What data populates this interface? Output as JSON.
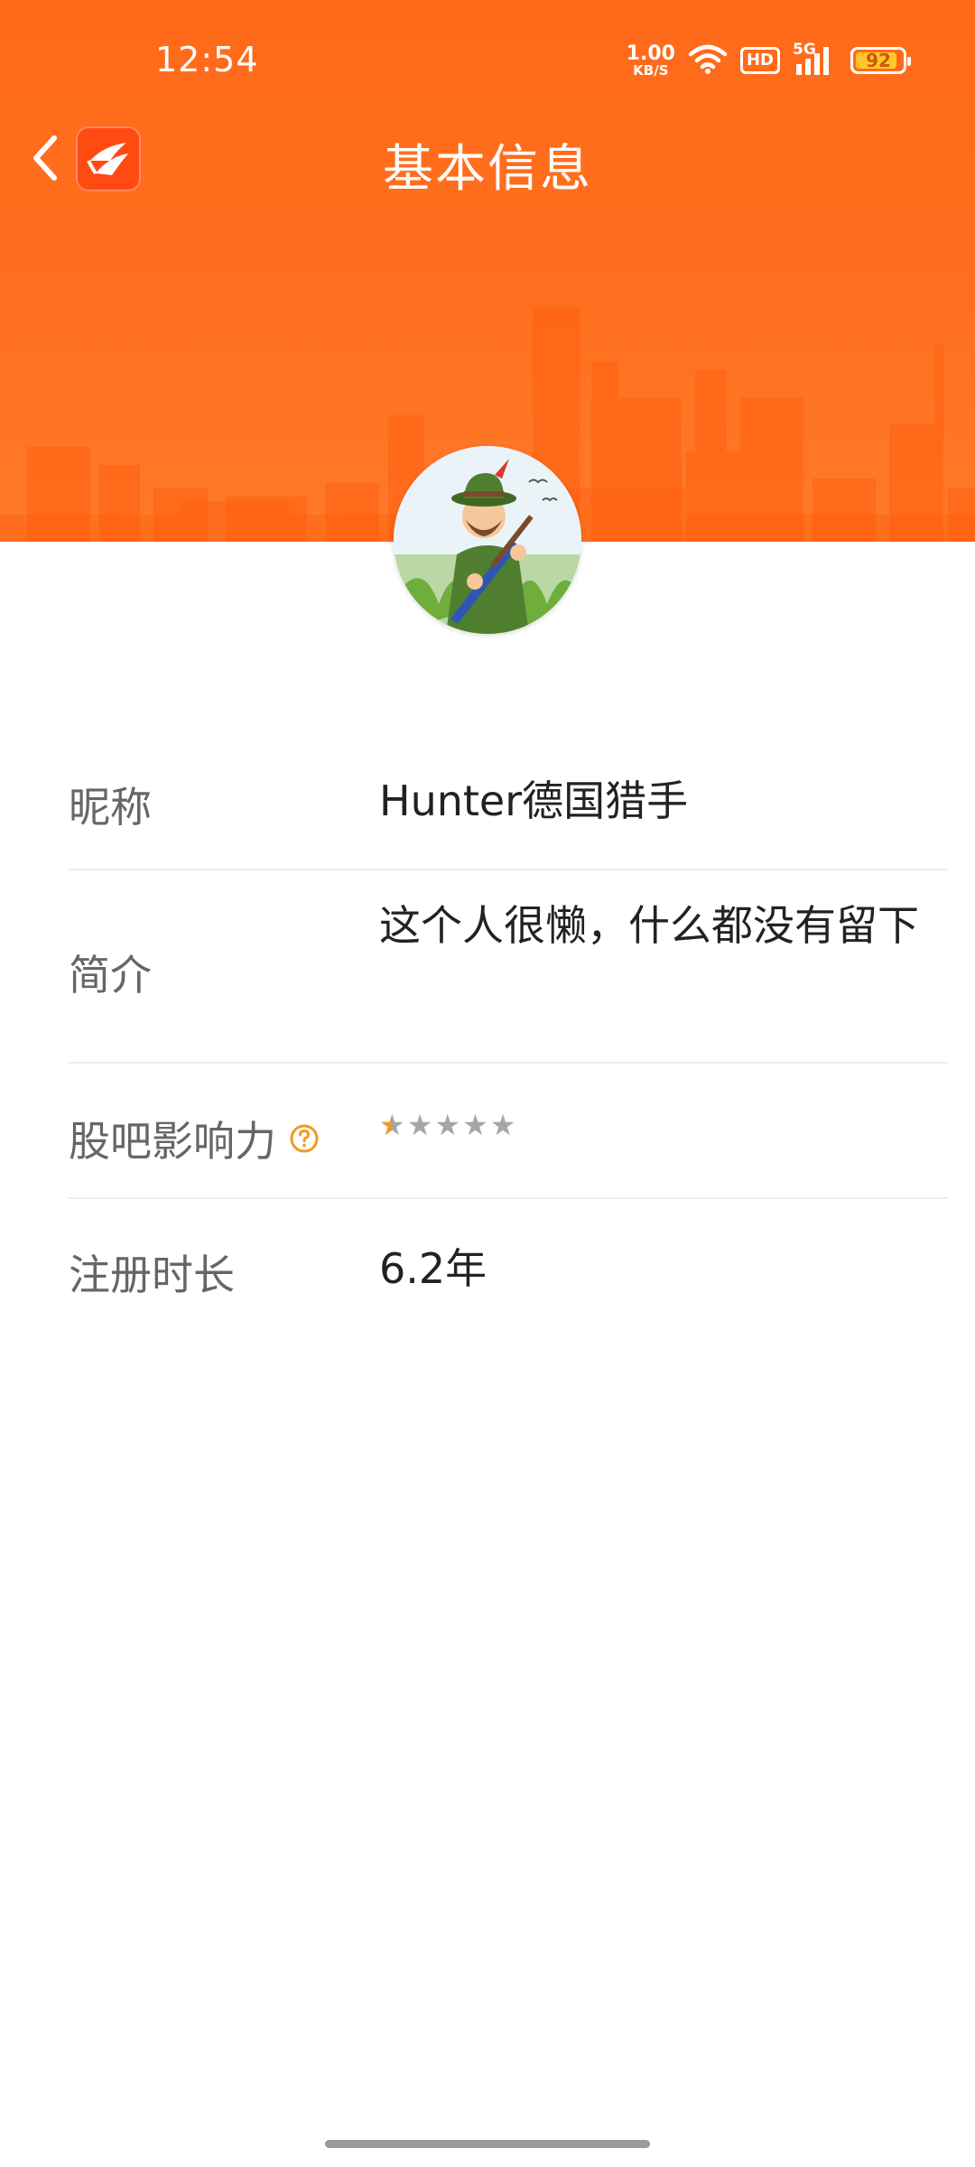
{
  "status_bar": {
    "time": "12:54",
    "net_speed_value": "1.00",
    "net_speed_unit": "KB/S",
    "hd_label": "HD",
    "signal_label": "5G",
    "battery_level": "92"
  },
  "header": {
    "title": "基本信息",
    "back_icon": "chevron-left-icon",
    "logo_icon": "app-logo-icon",
    "banner_color": "#ff6a1a"
  },
  "profile": {
    "avatar_icon": "hunter-avatar"
  },
  "info": {
    "nickname_label": "昵称",
    "nickname_value": "Hunter德国猎手",
    "intro_label": "简介",
    "intro_value": "这个人很懒，什么都没有留下",
    "influence_label": "股吧影响力",
    "influence_help_icon": "question-icon",
    "influence_stars_total": 5,
    "influence_stars_filled": 0.5,
    "register_label": "注册时长",
    "register_value": "6.2年"
  },
  "colors": {
    "accent": "#ff6a1a",
    "star_on": "#f39a1e",
    "star_off": "#a6a6a6",
    "label_text": "#666666",
    "value_text": "#222222"
  }
}
